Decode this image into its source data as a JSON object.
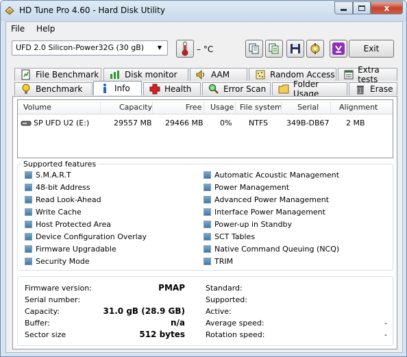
{
  "window": {
    "title": "HD Tune Pro 4.60 - Hard Disk Utility",
    "close_glyph": "x"
  },
  "menu": {
    "file": "File",
    "help": "Help"
  },
  "toolbar": {
    "drive": "UFD 2.0 Silicon-Power32G (30 gB)",
    "temperature": "– °C",
    "exit": "Exit"
  },
  "tabs": {
    "top": [
      "File Benchmark",
      "Disk monitor",
      "AAM",
      "Random Access",
      "Extra tests"
    ],
    "bottom": [
      "Benchmark",
      "Info",
      "Health",
      "Error Scan",
      "Folder Usage",
      "Erase"
    ],
    "active": "Info"
  },
  "volumes": {
    "headers": {
      "volume": "Volume",
      "capacity": "Capacity",
      "free": "Free",
      "usage": "Usage",
      "fs": "File system",
      "serial": "Serial",
      "alignment": "Alignment"
    },
    "rows": [
      {
        "volume": "SP UFD U2 (E:)",
        "capacity": "29557 MB",
        "free": "29466 MB",
        "usage": "0%",
        "fs": "NTFS",
        "serial": "349B-DB67",
        "alignment": "2 MB"
      }
    ]
  },
  "features": {
    "legend": "Supported features",
    "left": [
      "S.M.A.R.T",
      "48-bit Address",
      "Read Look-Ahead",
      "Write Cache",
      "Host Protected Area",
      "Device Configuration Overlay",
      "Firmware Upgradable",
      "Security Mode"
    ],
    "right": [
      "Automatic Acoustic Management",
      "Power Management",
      "Advanced Power Management",
      "Interface Power Management",
      "Power-up in Standby",
      "SCT Tables",
      "Native Command Queuing (NCQ)",
      "TRIM"
    ]
  },
  "details": {
    "firmware_label": "Firmware version:",
    "firmware_value": "PMAP",
    "serial_label": "Serial number:",
    "serial_value": "",
    "capacity_label": "Capacity:",
    "capacity_value": "31.0 gB (28.9 GB)",
    "buffer_label": "Buffer:",
    "buffer_value": "n/a",
    "sector_label": "Sector size",
    "sector_value": "512 bytes",
    "standard_label": "Standard:",
    "standard_value": "",
    "supported_label": "Supported:",
    "supported_value": "",
    "active_label": "Active:",
    "active_value": "",
    "avgspeed_label": "Average speed:",
    "avgspeed_value": "-",
    "rotation_label": "Rotation speed:",
    "rotation_value": "-"
  }
}
